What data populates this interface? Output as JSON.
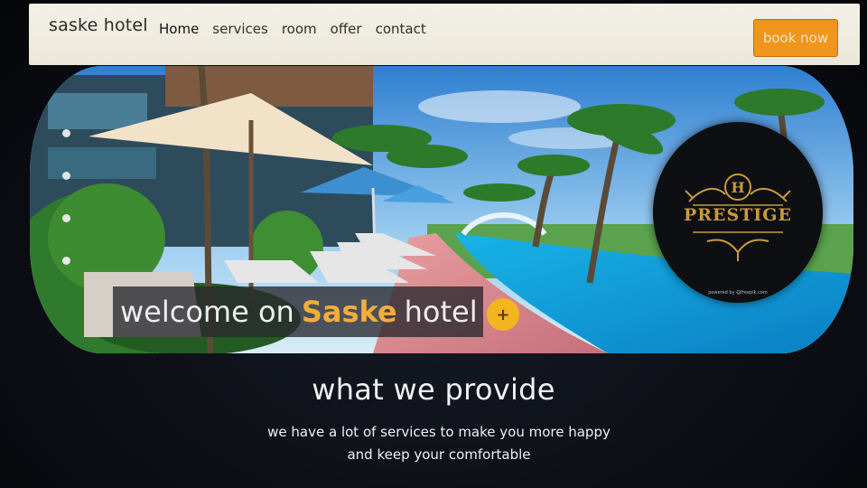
{
  "navbar": {
    "brand": "saske hotel",
    "links": [
      "Home",
      "services",
      "room",
      "offer",
      "contact"
    ],
    "cta_label": "book now"
  },
  "hero": {
    "welcome_prefix": "welcome on",
    "welcome_highlight": "Saske",
    "welcome_suffix": "hotel",
    "plus_label": "+",
    "slide_count": 4,
    "logo": {
      "initial": "H",
      "word": "PRESTIGE",
      "sub": "powered by @freepik.com"
    }
  },
  "provide": {
    "title": "what we provide",
    "line1": "we have a lot of services to make you more happy",
    "line2": "and keep your comfortable"
  },
  "colors": {
    "accent": "#f0961d",
    "highlight": "#f3ad3c",
    "logo_gold": "#c99a3c"
  }
}
